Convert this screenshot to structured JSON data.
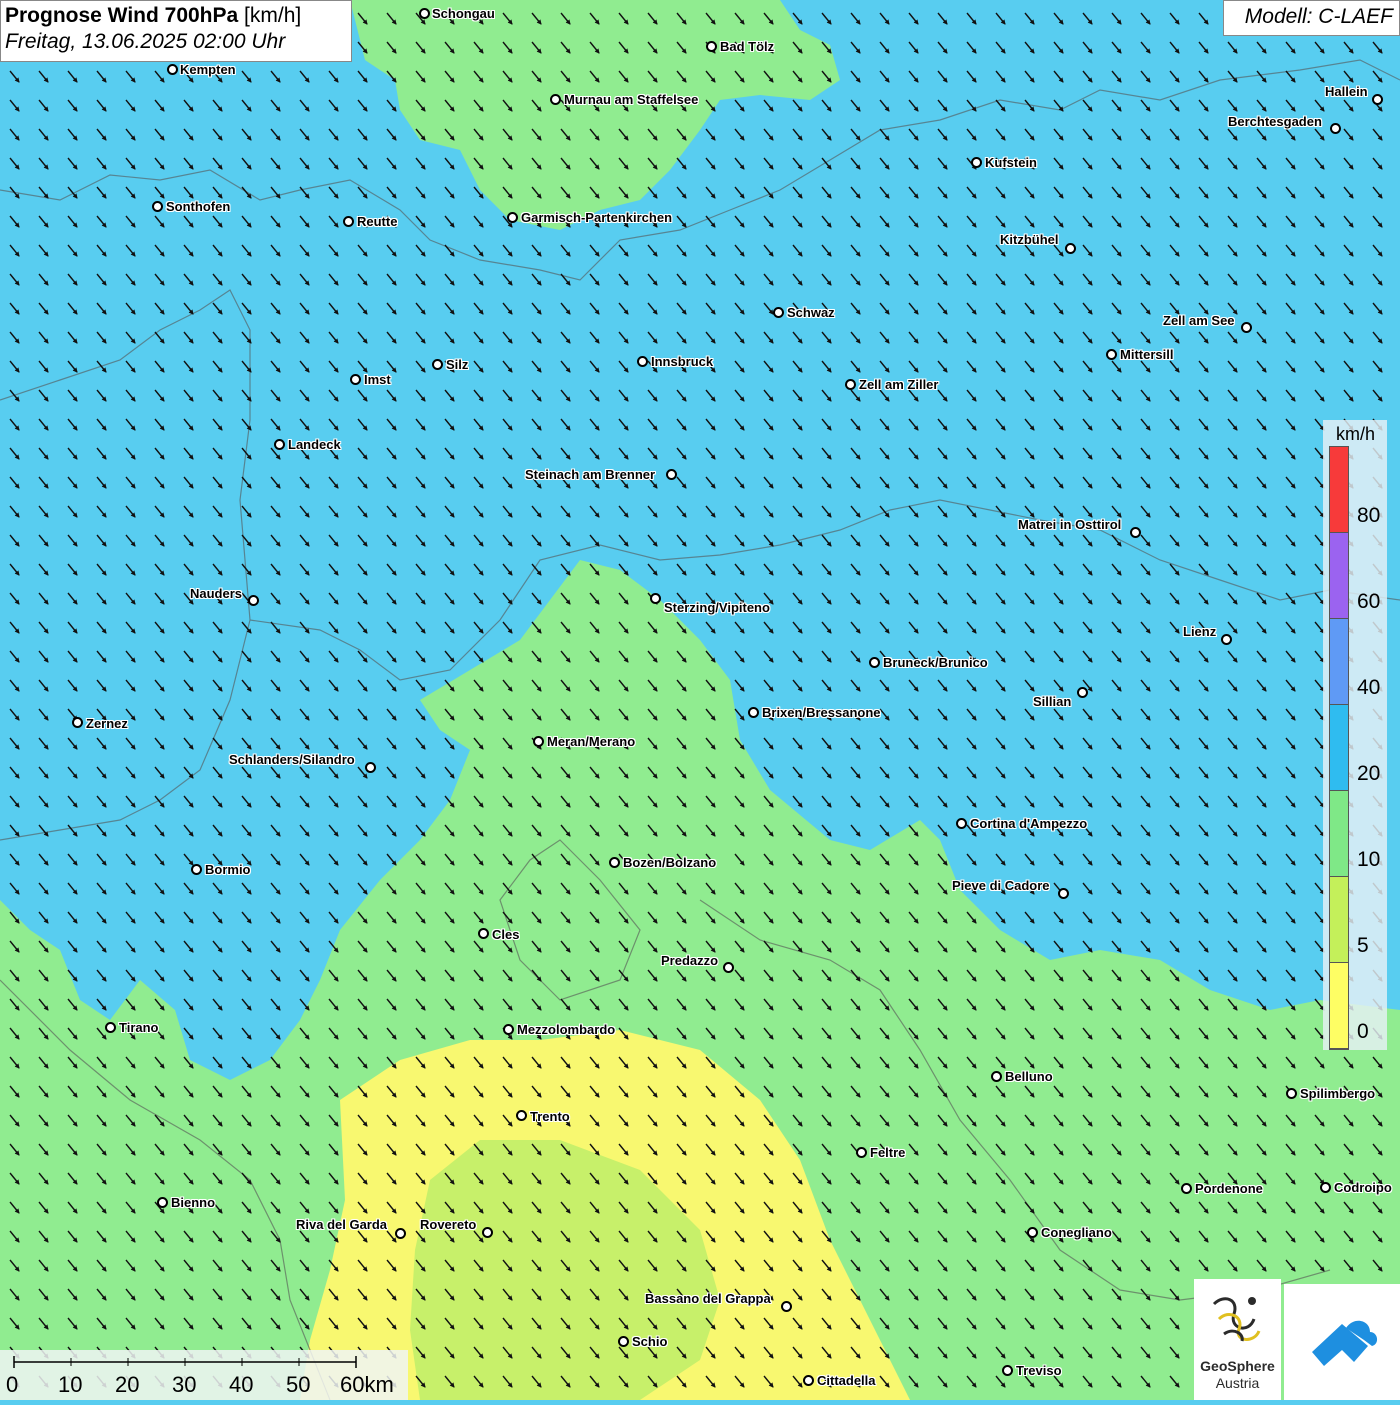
{
  "header": {
    "title_bold": "Prognose Wind 700hPa",
    "title_unit": " [km/h]",
    "subtitle": "Freitag, 13.06.2025 02:00 Uhr"
  },
  "model_label": "Modell: C-LAEF",
  "legend": {
    "unit": "km/h",
    "ticks": [
      "80",
      "60",
      "40",
      "20",
      "10",
      "5",
      "0"
    ],
    "colors": [
      "#f73a3a",
      "#9b63f0",
      "#5f9af5",
      "#2fbcf0",
      "#7fe887",
      "#c4f05a",
      "#fefe64"
    ]
  },
  "scale_bar": {
    "labels": [
      "0",
      "10",
      "20",
      "30",
      "40",
      "50",
      "60km"
    ]
  },
  "logos": {
    "geosphere_name": "GeoSphere",
    "geosphere_sub": "Austria"
  },
  "colors": {
    "wind_blue": "#58cdf0",
    "wind_green": "#90ec90",
    "wind_yellow": "#f8f870"
  },
  "cities": [
    "Schongau",
    "Bad Tölz",
    "Kempten",
    "Murnau am Staffelsee",
    "Hallein",
    "Berchtesgaden",
    "Kufstein",
    "Sonthofen",
    "Reutte",
    "Garmisch-Partenkirchen",
    "Kitzbühel",
    "Schwaz",
    "Zell am See",
    "Innsbruck",
    "Mittersill",
    "Silz",
    "Imst",
    "Zell am Ziller",
    "Landeck",
    "Steinach am Brenner",
    "Matrei in Osttirol",
    "Nauders",
    "Sterzing/Vipiteno",
    "Lienz",
    "Bruneck/Brunico",
    "Sillian",
    "Zernez",
    "Brixen/Bressanone",
    "Meran/Merano",
    "Schlanders/Silandro",
    "Cortina d'Ampezzo",
    "Bozen/Bolzano",
    "Bormio",
    "Pieve di Cadore",
    "Cles",
    "Predazzo",
    "Tirano",
    "Mezzolombardo",
    "Belluno",
    "Spilimbergo",
    "Trento",
    "Feltre",
    "Pordenone",
    "Codroipo",
    "Bienno",
    "Riva del Garda",
    "Rovereto",
    "Conegliano",
    "Bassano del Grappa",
    "Schio",
    "Treviso",
    "Cittadella"
  ]
}
